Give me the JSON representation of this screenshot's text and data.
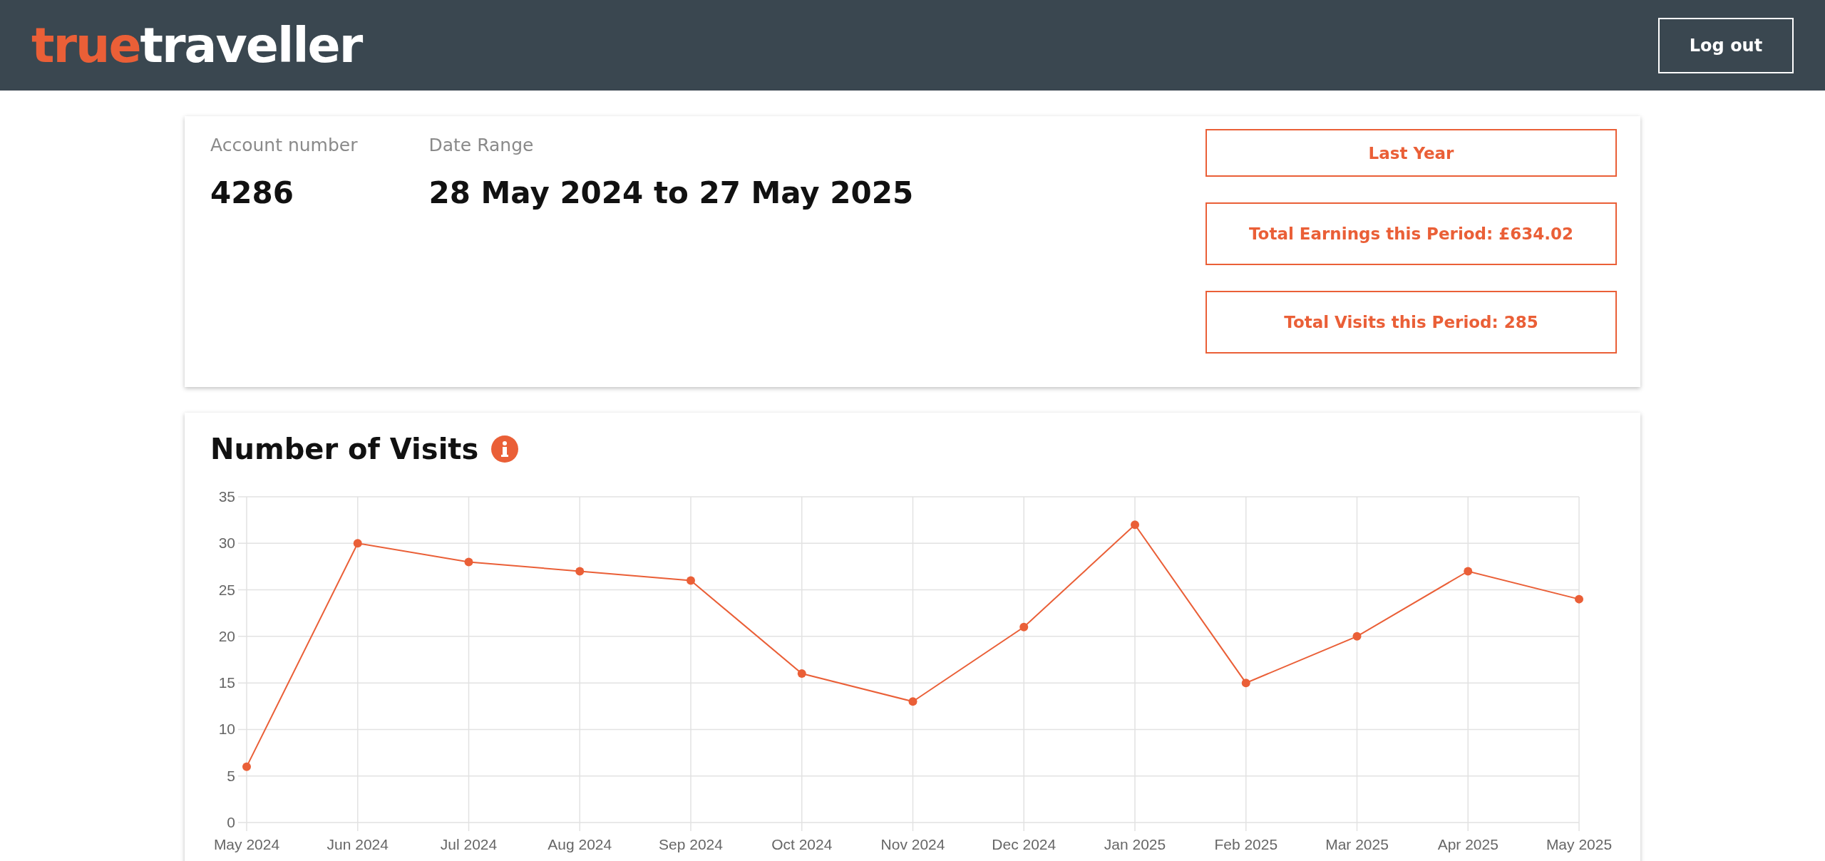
{
  "header": {
    "logo": {
      "accent": "true",
      "rest": "traveller"
    },
    "logout_button": "Log out"
  },
  "summary": {
    "fields": [
      {
        "label": "Account number",
        "value": "4286"
      },
      {
        "label": "Date Range",
        "value": "28 May 2024 to 27 May 2025"
      }
    ],
    "buttons": [
      "Last Year",
      "Total Earnings this Period: £634.02",
      "Total Visits this Period: 285"
    ]
  },
  "visits_panel": {
    "title": "Number of Visits",
    "chart_data": {
      "type": "line",
      "categories": [
        "May 2024",
        "Jun 2024",
        "Jul 2024",
        "Aug 2024",
        "Sep 2024",
        "Oct 2024",
        "Nov 2024",
        "Dec 2024",
        "Jan 2025",
        "Feb 2025",
        "Mar 2025",
        "Apr 2025",
        "May 2025"
      ],
      "grid": true,
      "series": [
        {
          "marker": true,
          "color": "#ea5f37",
          "values": [
            6,
            30,
            28,
            27,
            26,
            16,
            13,
            21,
            32,
            15,
            20,
            27,
            24
          ]
        }
      ],
      "ylim": [
        0,
        35
      ],
      "yticks": [
        0,
        5,
        10,
        15,
        20,
        25,
        30,
        35
      ]
    }
  }
}
